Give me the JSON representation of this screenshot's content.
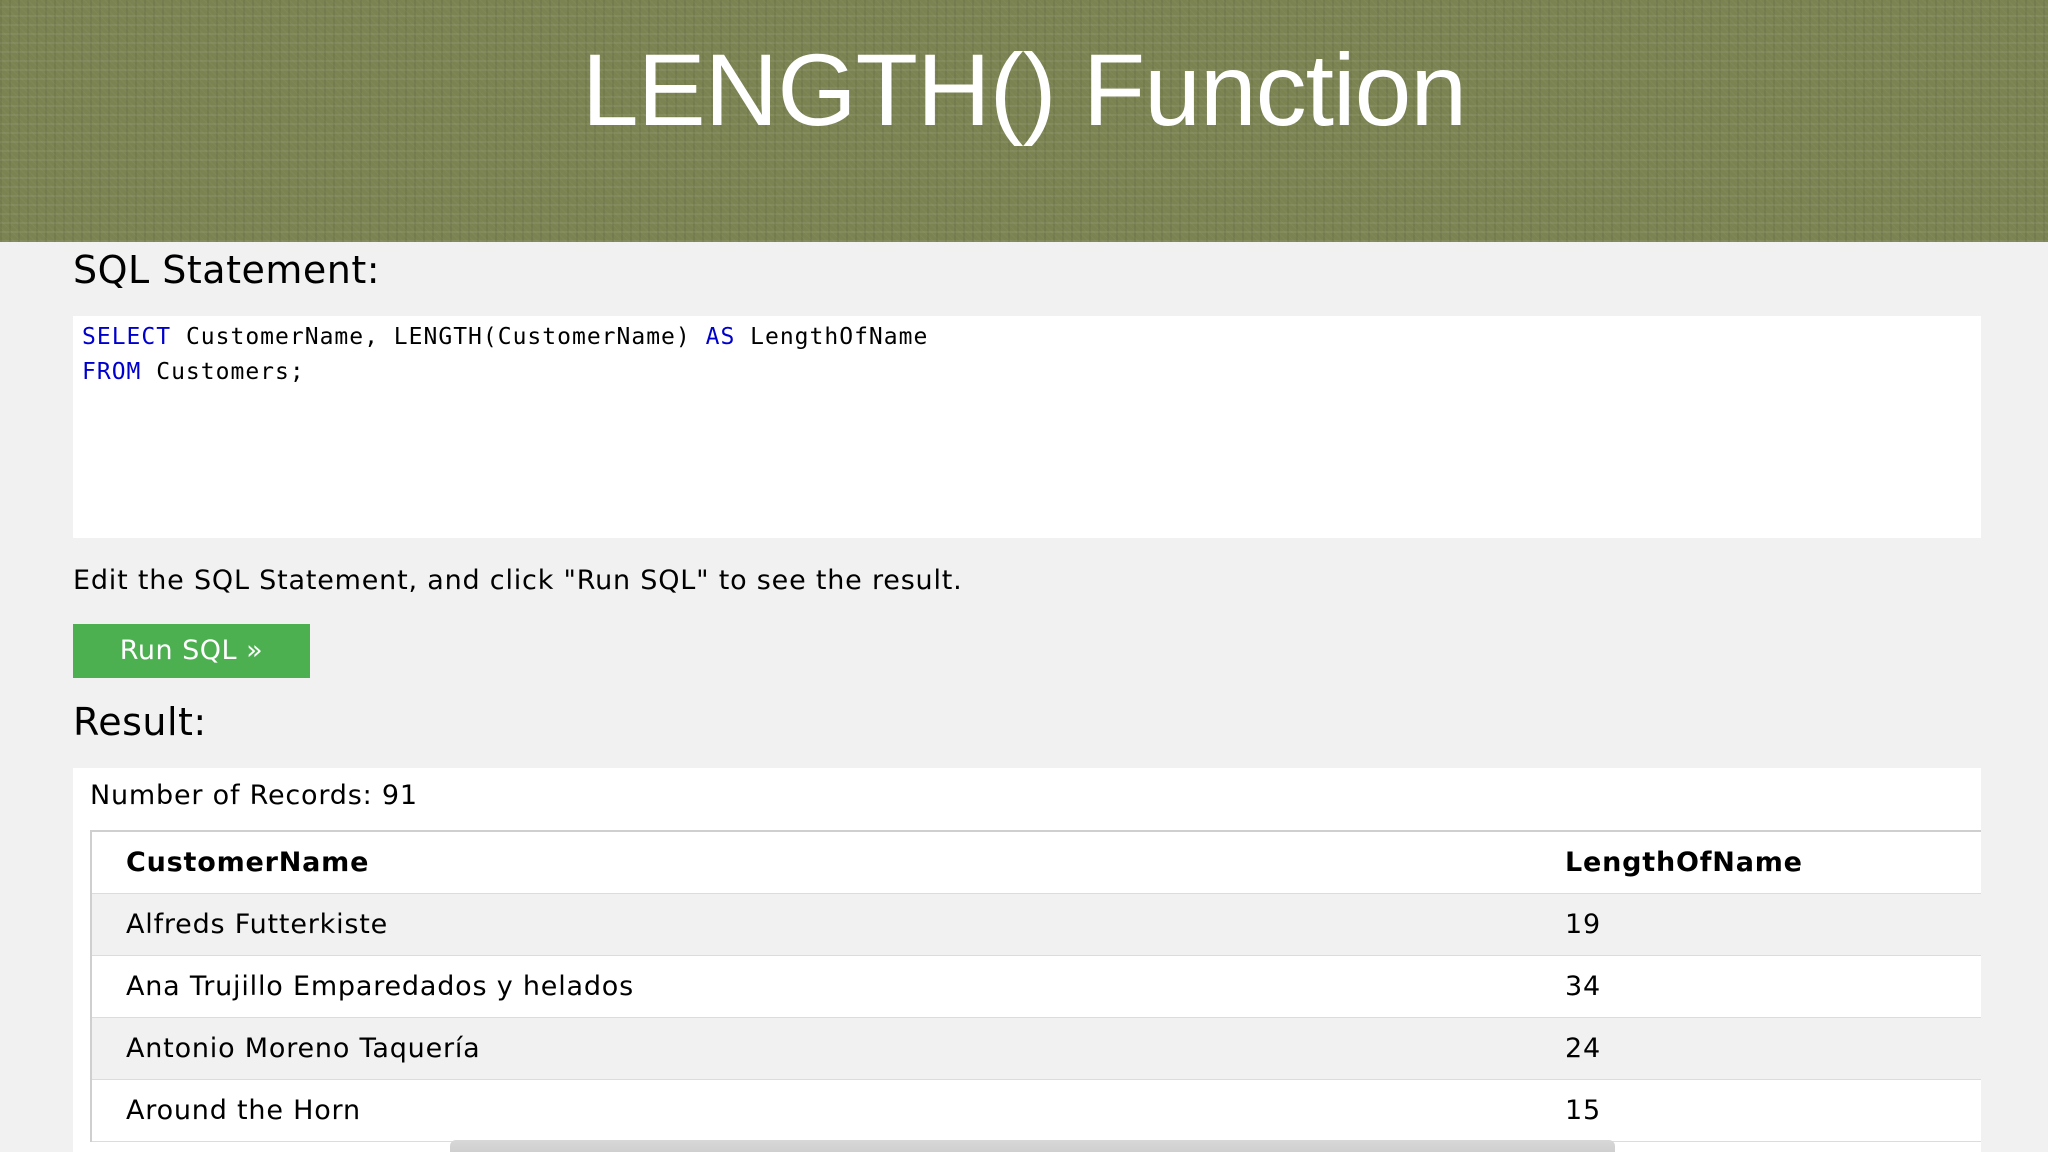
{
  "slide": {
    "title": "LENGTH() Function"
  },
  "editor": {
    "heading": "SQL Statement:",
    "code": {
      "line1_kw1": "SELECT",
      "line1_mid": " CustomerName, LENGTH(CustomerName) ",
      "line1_kw2": "AS",
      "line1_end": " LengthOfName",
      "line2_kw": "FROM",
      "line2_end": " Customers;"
    },
    "instruction": "Edit the SQL Statement, and click \"Run SQL\" to see the result.",
    "run_button_label": "Run SQL »"
  },
  "result": {
    "heading": "Result:",
    "record_count": "Number of Records: 91",
    "columns": [
      "CustomerName",
      "LengthOfName"
    ],
    "rows": [
      [
        "Alfreds Futterkiste",
        "19"
      ],
      [
        "Ana Trujillo Emparedados y helados",
        "34"
      ],
      [
        "Antonio Moreno Taquería",
        "24"
      ],
      [
        "Around the Horn",
        "15"
      ]
    ]
  },
  "colors": {
    "banner": "#7b8352",
    "keyword": "#0000cd",
    "button": "#4caf50"
  }
}
